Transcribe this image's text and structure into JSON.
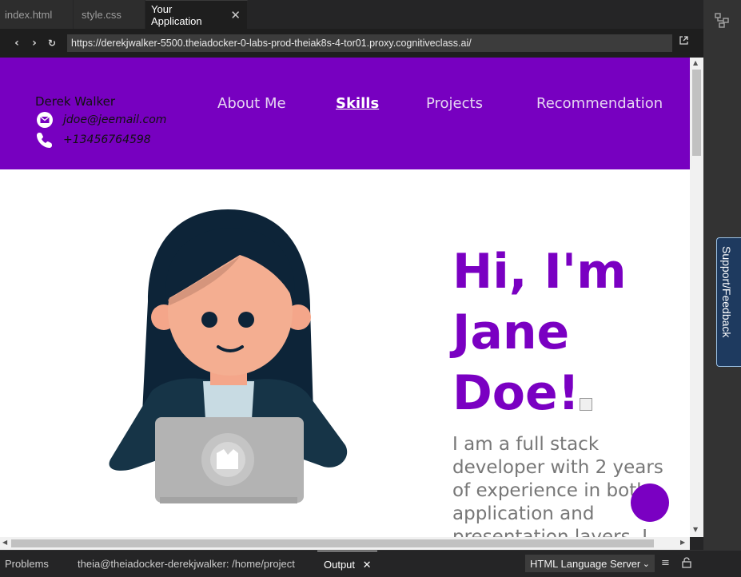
{
  "tabs": [
    {
      "label": "index.html",
      "active": false
    },
    {
      "label": "style.css",
      "active": false
    },
    {
      "label": "Your Application",
      "active": true
    }
  ],
  "browser": {
    "url": "https://derekjwalker-5500.theiadocker-0-labs-prod-theiak8s-4-tor01.proxy.cognitiveclass.ai/"
  },
  "site": {
    "accent": "#7700c0",
    "name": "Derek Walker",
    "email": "jdoe@jeemail.com",
    "phone": "+13456764598",
    "nav": [
      {
        "label": "About Me",
        "active": false
      },
      {
        "label": "Skills",
        "active": true
      },
      {
        "label": "Projects",
        "active": false
      },
      {
        "label": "Recommendation",
        "active": false
      }
    ],
    "hero_title": "Hi, I'm Jane Doe!",
    "hero_desc": "I am a full stack developer with 2 years of experience in both application and presentation layers. I"
  },
  "sidebar": {
    "support_label": "Support/Feedback"
  },
  "panel": {
    "tabs": [
      {
        "label": "Problems",
        "active": false
      },
      {
        "label": "theia@theiadocker-derekjwalker: /home/project",
        "active": false
      },
      {
        "label": "Output",
        "active": true
      }
    ],
    "language_server": "HTML Language Server"
  }
}
